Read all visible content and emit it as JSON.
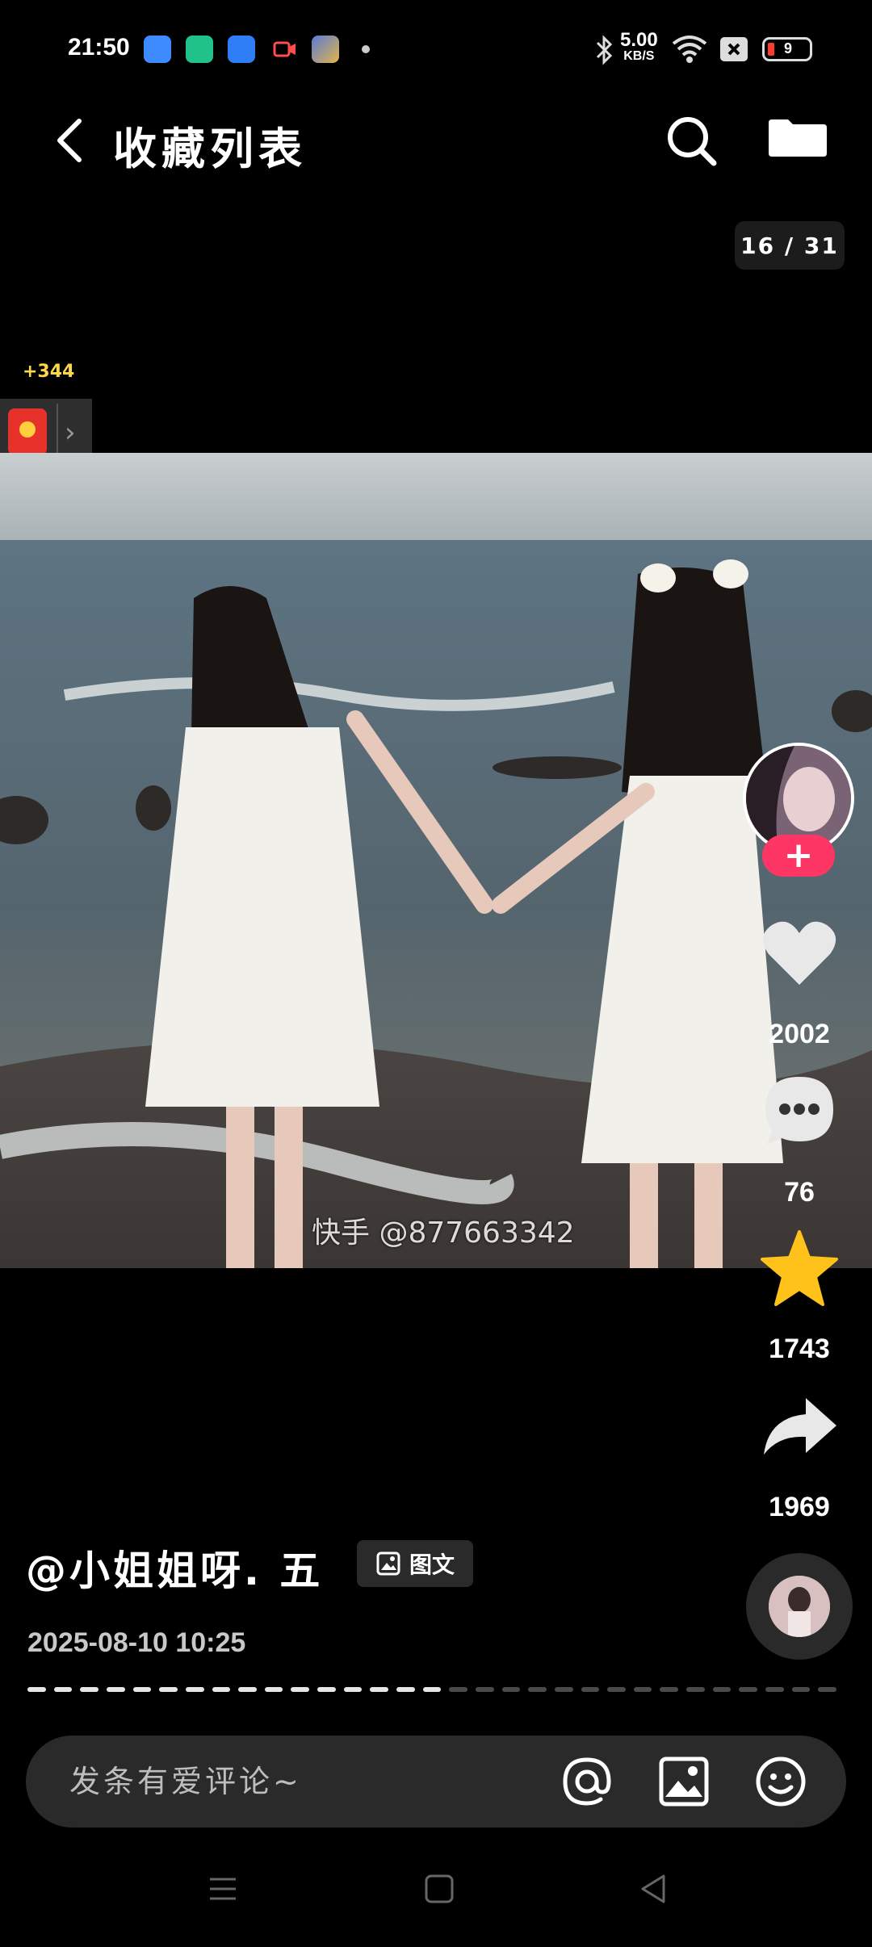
{
  "status_bar": {
    "time": "21:50",
    "net_speed_value": "5.00",
    "net_speed_unit": "KB/S",
    "battery_level": "9",
    "notification_icons": [
      "weather-icon",
      "battery-app-icon",
      "browser-icon",
      "screen-record-icon",
      "game-icon"
    ],
    "right_icons": [
      "bluetooth-icon",
      "wifi-icon",
      "sim-off-icon",
      "battery-icon"
    ]
  },
  "header": {
    "title": "收藏列表",
    "back_icon": "chevron-left-icon",
    "search_icon": "search-icon",
    "folder_icon": "folder-icon"
  },
  "page_counter": "16 / 31",
  "reward": {
    "count": "+344",
    "icon": "red-envelope-icon",
    "arrow": "›"
  },
  "photo": {
    "watermark": "快手 @877663342"
  },
  "actions": {
    "follow_label": "+",
    "like_count": "2002",
    "comment_count": "76",
    "favorite_count": "1743",
    "share_count": "1969",
    "colors": {
      "follow": "#fe3666",
      "favorite": "#ffc21a",
      "heart": "#e8e8e8"
    }
  },
  "post": {
    "author": "@小姐姐呀. 五",
    "type_label": "图文",
    "time": "2025-08-10  10:25",
    "progress": {
      "current": 16,
      "total": 31
    }
  },
  "comment_bar": {
    "placeholder": "发条有爱评论~",
    "icons": [
      "at-icon",
      "image-icon",
      "emoji-icon"
    ]
  },
  "nav": {
    "icons": [
      "menu-icon",
      "home-icon",
      "back-icon"
    ]
  }
}
